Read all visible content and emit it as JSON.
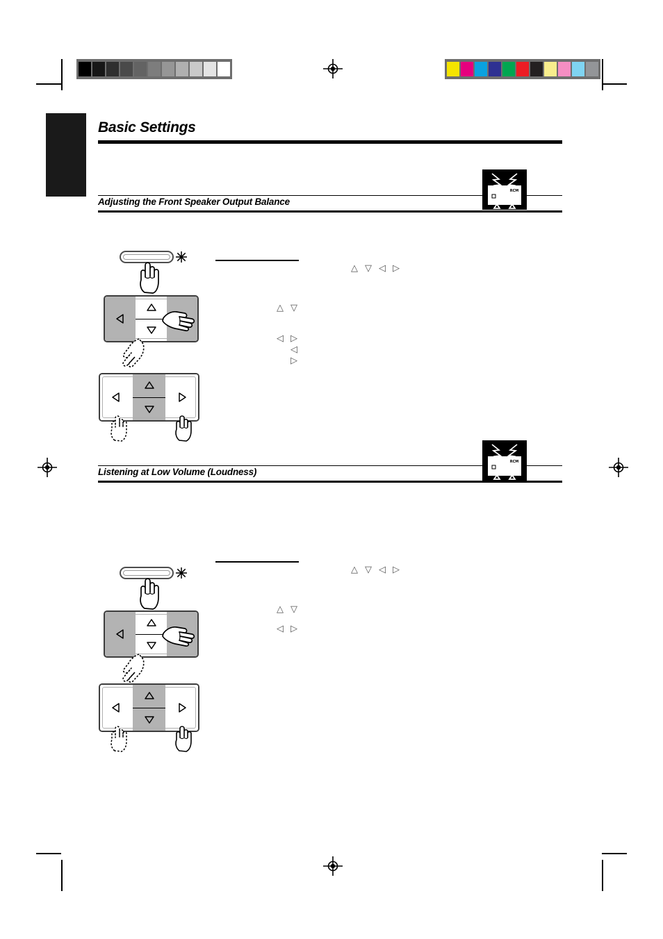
{
  "document": {
    "page_title": "Basic Settings",
    "sections": [
      {
        "heading": "Adjusting the Front Speaker Output Balance",
        "icon": "tv-monitor-icon",
        "icon_label": "RCM"
      },
      {
        "heading": "Listening at Low Volume (Loudness)",
        "icon": "tv-monitor-icon",
        "icon_label": "RCM"
      }
    ]
  },
  "calibration": {
    "grayscale_label": "grayscale-calibration-strip",
    "grayscale_patches": [
      "#000000",
      "#171717",
      "#2f2f2f",
      "#4a4a4a",
      "#636363",
      "#7d7d7d",
      "#969696",
      "#b0b0b0",
      "#c9c9c9",
      "#e4e4e4",
      "#ffffff"
    ],
    "color_label": "color-calibration-strip",
    "color_patches": [
      "#f5e400",
      "#e6007e",
      "#0aa2e0",
      "#2e3192",
      "#00a651",
      "#ed1c24",
      "#231f20",
      "#f8ed8d",
      "#f58ec3",
      "#7fd4f2",
      "#939598"
    ]
  },
  "marks": {
    "registration_label": "registration-target",
    "crop_label": "crop-mark"
  },
  "glyphs": {
    "up": "△",
    "down": "▽",
    "left": "◁",
    "right": "▷",
    "names": {
      "up": "up-arrow-glyph",
      "down": "down-arrow-glyph",
      "left": "left-arrow-glyph",
      "right": "right-arrow-glyph"
    }
  },
  "diagrams": {
    "section1": {
      "button": {
        "name": "remote-mode-button",
        "flash": "press-flash-starburst"
      },
      "dpad_first": {
        "name": "remote-dpad-sides-highlighted",
        "left_state": "highlighted",
        "right_state": "highlighted",
        "up_state": "normal",
        "down_state": "normal"
      },
      "dpad_second": {
        "name": "remote-dpad-center-highlighted",
        "left_state": "normal",
        "right_state": "normal",
        "up_state": "highlighted",
        "down_state": "highlighted"
      }
    },
    "section2": {
      "button": {
        "name": "remote-mode-button",
        "flash": "press-flash-starburst"
      },
      "dpad_first": {
        "name": "remote-dpad-sides-highlighted",
        "left_state": "highlighted",
        "right_state": "highlighted",
        "up_state": "normal",
        "down_state": "normal"
      },
      "dpad_second": {
        "name": "remote-dpad-center-highlighted",
        "left_state": "normal",
        "right_state": "normal",
        "up_state": "highlighted",
        "down_state": "highlighted"
      }
    }
  },
  "arrow_rows": {
    "s1_r1": [
      "△",
      "▽",
      "◁",
      "▷"
    ],
    "s1_r2": [
      "△",
      "▽"
    ],
    "s1_r3": [
      "◁",
      "▷"
    ],
    "s1_r4": [
      "◁"
    ],
    "s1_r5": [
      "▷"
    ],
    "s2_r1": [
      "△",
      "▽",
      "◁",
      "▷"
    ],
    "s2_r2": [
      "△",
      "▽"
    ],
    "s2_r3": [
      "◁",
      "▷"
    ]
  }
}
